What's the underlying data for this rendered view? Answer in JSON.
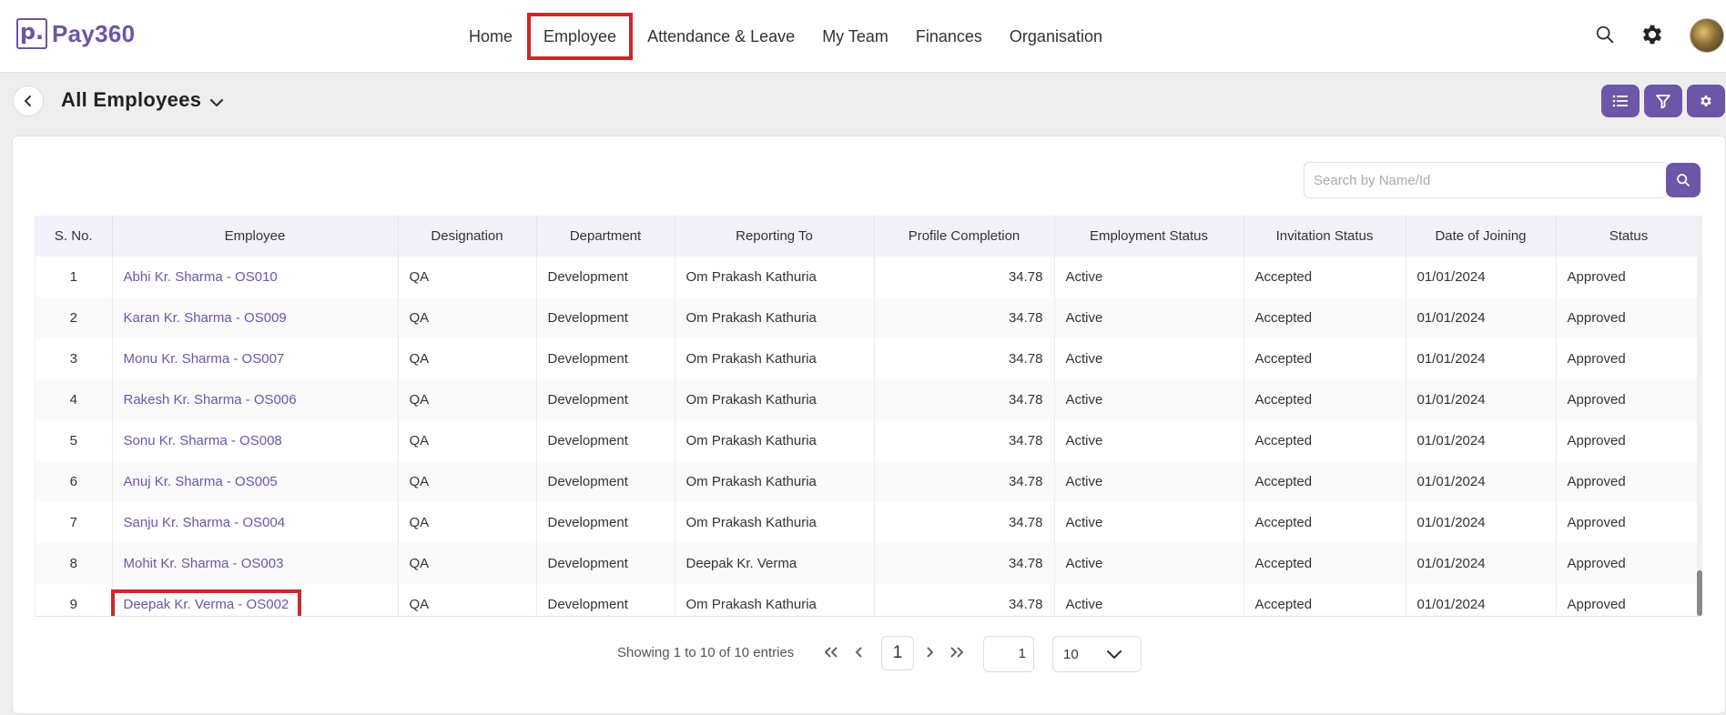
{
  "brand": {
    "mark": "p.",
    "name": "Pay360"
  },
  "nav": [
    "Home",
    "Employee",
    "Attendance & Leave",
    "My Team",
    "Finances",
    "Organisation"
  ],
  "page": {
    "title": "All Employees"
  },
  "search": {
    "placeholder": "Search by Name/Id"
  },
  "table": {
    "columns": [
      "S. No.",
      "Employee",
      "Designation",
      "Department",
      "Reporting To",
      "Profile Completion",
      "Employment Status",
      "Invitation Status",
      "Date of Joining",
      "Status"
    ],
    "rows": [
      [
        "1",
        "Abhi Kr. Sharma - OS010",
        "QA",
        "Development",
        "Om Prakash Kathuria",
        "34.78",
        "Active",
        "Accepted",
        "01/01/2024",
        "Approved"
      ],
      [
        "2",
        "Karan Kr. Sharma - OS009",
        "QA",
        "Development",
        "Om Prakash Kathuria",
        "34.78",
        "Active",
        "Accepted",
        "01/01/2024",
        "Approved"
      ],
      [
        "3",
        "Monu Kr. Sharma - OS007",
        "QA",
        "Development",
        "Om Prakash Kathuria",
        "34.78",
        "Active",
        "Accepted",
        "01/01/2024",
        "Approved"
      ],
      [
        "4",
        "Rakesh Kr. Sharma - OS006",
        "QA",
        "Development",
        "Om Prakash Kathuria",
        "34.78",
        "Active",
        "Accepted",
        "01/01/2024",
        "Approved"
      ],
      [
        "5",
        "Sonu Kr. Sharma - OS008",
        "QA",
        "Development",
        "Om Prakash Kathuria",
        "34.78",
        "Active",
        "Accepted",
        "01/01/2024",
        "Approved"
      ],
      [
        "6",
        "Anuj Kr. Sharma - OS005",
        "QA",
        "Development",
        "Om Prakash Kathuria",
        "34.78",
        "Active",
        "Accepted",
        "01/01/2024",
        "Approved"
      ],
      [
        "7",
        "Sanju Kr. Sharma - OS004",
        "QA",
        "Development",
        "Om Prakash Kathuria",
        "34.78",
        "Active",
        "Accepted",
        "01/01/2024",
        "Approved"
      ],
      [
        "8",
        "Mohit Kr. Sharma - OS003",
        "QA",
        "Development",
        "Deepak Kr. Verma",
        "34.78",
        "Active",
        "Accepted",
        "01/01/2024",
        "Approved"
      ],
      [
        "9",
        "Deepak Kr. Verma - OS002",
        "QA",
        "Development",
        "Om Prakash Kathuria",
        "34.78",
        "Active",
        "Accepted",
        "01/01/2024",
        "Approved"
      ]
    ]
  },
  "pagination": {
    "summary": "Showing 1 to 10 of 10 entries",
    "current_page": "1",
    "goto_page": "1",
    "page_size": "10"
  },
  "colors": {
    "accent": "#6d55a8",
    "highlight": "#d1262b"
  }
}
